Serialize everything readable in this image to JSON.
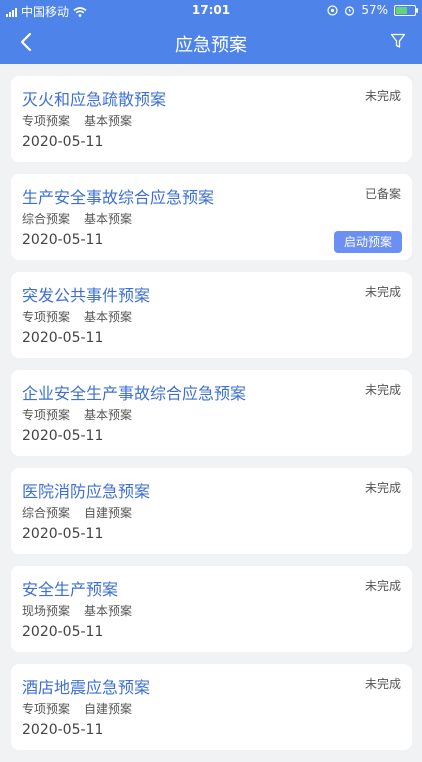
{
  "statusbar": {
    "carrier": "中国移动",
    "time": "17:01",
    "battery": "57%",
    "battery_level": 0.57
  },
  "header": {
    "title": "应急预案"
  },
  "items": [
    {
      "title": "灭火和应急疏散预案",
      "status": "未完成",
      "tag1": "专项预案",
      "tag2": "基本预案",
      "date": "2020-05-11"
    },
    {
      "title": "生产安全事故综合应急预案",
      "status": "已备案",
      "tag1": "综合预案",
      "tag2": "基本预案",
      "date": "2020-05-11",
      "action": "启动预案"
    },
    {
      "title": "突发公共事件预案",
      "status": "未完成",
      "tag1": "专项预案",
      "tag2": "基本预案",
      "date": "2020-05-11"
    },
    {
      "title": "企业安全生产事故综合应急预案",
      "status": "未完成",
      "tag1": "专项预案",
      "tag2": "基本预案",
      "date": "2020-05-11"
    },
    {
      "title": "医院消防应急预案",
      "status": "未完成",
      "tag1": "综合预案",
      "tag2": "自建预案",
      "date": "2020-05-11"
    },
    {
      "title": "安全生产预案",
      "status": "未完成",
      "tag1": "现场预案",
      "tag2": "基本预案",
      "date": "2020-05-11"
    },
    {
      "title": "酒店地震应急预案",
      "status": "未完成",
      "tag1": "专项预案",
      "tag2": "自建预案",
      "date": "2020-05-11"
    }
  ]
}
